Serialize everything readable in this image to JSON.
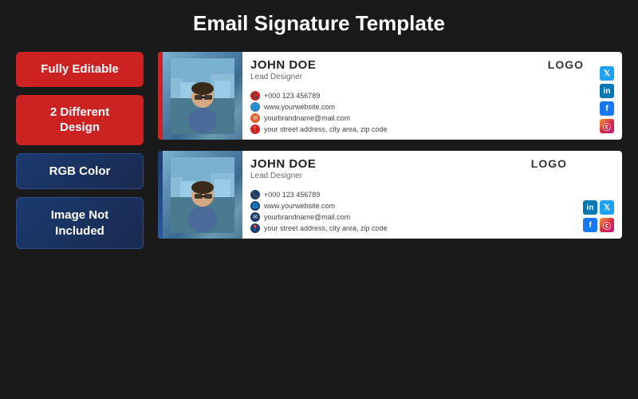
{
  "page": {
    "title": "Email Signature Template",
    "bg_color": "#1a1a1a"
  },
  "badges": [
    {
      "id": "fully-editable",
      "text": "Fully Editable",
      "style": "red"
    },
    {
      "id": "different-design",
      "text": "2 Different\nDesign",
      "style": "red"
    },
    {
      "id": "rgb-color",
      "text": "RGB Color",
      "style": "navy"
    },
    {
      "id": "image-not-included",
      "text": "Image Not\nIncluded",
      "style": "navy"
    }
  ],
  "signatures": [
    {
      "id": "sig1",
      "style": "red",
      "name": "JOHN DOE",
      "title": "Lead Designer",
      "logo": "LOGO",
      "contacts": [
        {
          "type": "phone",
          "value": "+000 123 456789"
        },
        {
          "type": "web",
          "value": "www.yourwebsite.com"
        },
        {
          "type": "email",
          "value": "yourbrandname@mail.com"
        },
        {
          "type": "address",
          "value": "your street address, city area, zip code"
        }
      ],
      "socials": [
        "twitter",
        "linkedin",
        "facebook",
        "instagram"
      ]
    },
    {
      "id": "sig2",
      "style": "navy",
      "name": "JOHN DOE",
      "title": "Lead Designer",
      "logo": "LOGO",
      "contacts": [
        {
          "type": "phone",
          "value": "+000 123 456789"
        },
        {
          "type": "web",
          "value": "www.yourwebsite.com"
        },
        {
          "type": "email",
          "value": "yourbrandname@mail.com"
        },
        {
          "type": "address",
          "value": "your street address, city area, zip code"
        }
      ],
      "socials": [
        "linkedin",
        "twitter",
        "facebook",
        "instagram"
      ]
    }
  ]
}
